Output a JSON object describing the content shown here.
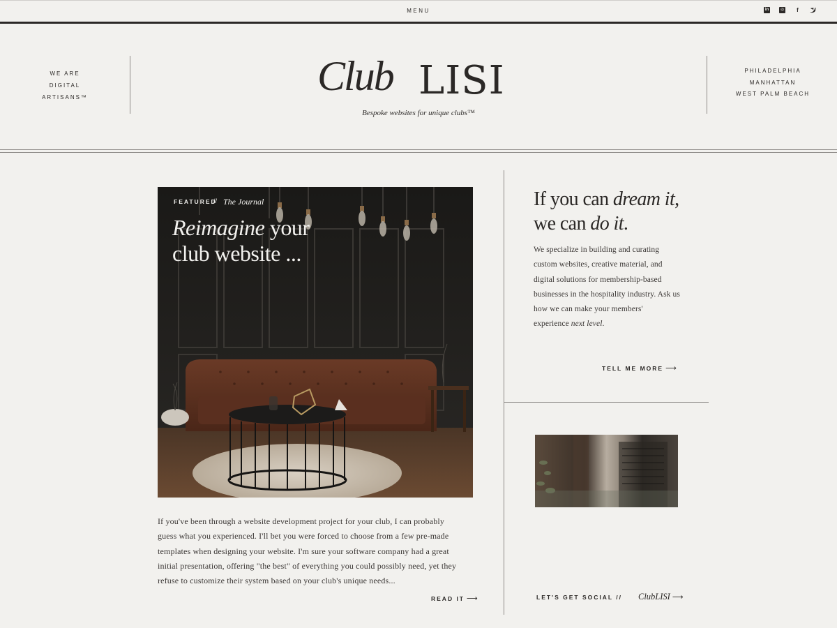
{
  "topbar": {
    "menu_label": "MENU",
    "socials": [
      {
        "icon": "linkedin-icon",
        "glyph": "in"
      },
      {
        "icon": "instagram-icon",
        "glyph": "◎"
      },
      {
        "icon": "facebook-icon",
        "glyph": "f"
      },
      {
        "icon": "twitter-icon",
        "glyph": "✓"
      }
    ]
  },
  "header": {
    "left_lines": [
      "WE ARE",
      "DIGITAL",
      "ARTISANS™"
    ],
    "logo_script": "Club",
    "logo_caps": "LISI",
    "tagline": "Bespoke websites for unique clubs™",
    "right_lines": [
      "PHILADELPHIA",
      "MANHATTAN",
      "WEST PALM BEACH"
    ]
  },
  "featured": {
    "label": "FEATURED",
    "separator": "//",
    "category": "The Journal",
    "title_italic": "Reimagine",
    "title_rest_1": " your",
    "title_line_2": "club website ...",
    "excerpt": "If you've been through a website development project for your club, I can probably guess what you experienced. I'll bet you were forced to choose from a few pre-made templates when designing your website. I'm sure your software company had a great initial presentation, offering \"the best\" of everything you could possibly need, yet they refuse to customize their system based on your club's unique needs...",
    "read_label": "READ IT"
  },
  "about": {
    "h_part1": "If you can ",
    "h_italic1": "dream it",
    "h_part2": ",",
    "h_part3": "we can ",
    "h_italic2": "do it",
    "h_part4": ".",
    "body": "We specialize in building and curating custom websites, creative material, and digital solutions for membership-based businesses in the hospitality industry. Ask us how we can make your members' experience ",
    "body_italic": "next level",
    "body_end": ".",
    "cta_label": "TELL ME MORE"
  },
  "social": {
    "label": "LET'S GET SOCIAL //",
    "link": "ClubLISI"
  },
  "colors": {
    "background": "#f2f1ee",
    "ink": "#2b2826",
    "rule": "#8e8b88"
  }
}
